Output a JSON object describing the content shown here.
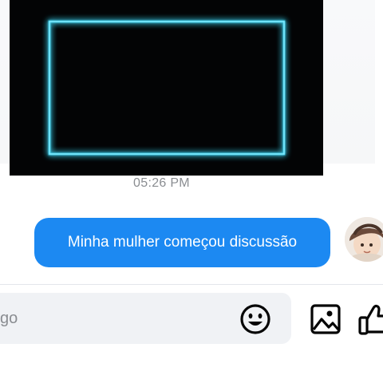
{
  "message_list": {
    "video": {
      "frame_color": "#45d8f5",
      "background": "#030405"
    },
    "timestamp": "05:26 PM",
    "outgoing_message": {
      "text": "Minha mulher começou discussão",
      "bubble_color": "#1c89f2"
    },
    "sender_avatar": {
      "description_icon": "avatar-icon"
    }
  },
  "composer": {
    "placeholder_visible": "go",
    "emoji_icon": "smiley-icon",
    "gallery_icon": "image-icon",
    "like_icon": "thumbs-up-icon"
  }
}
